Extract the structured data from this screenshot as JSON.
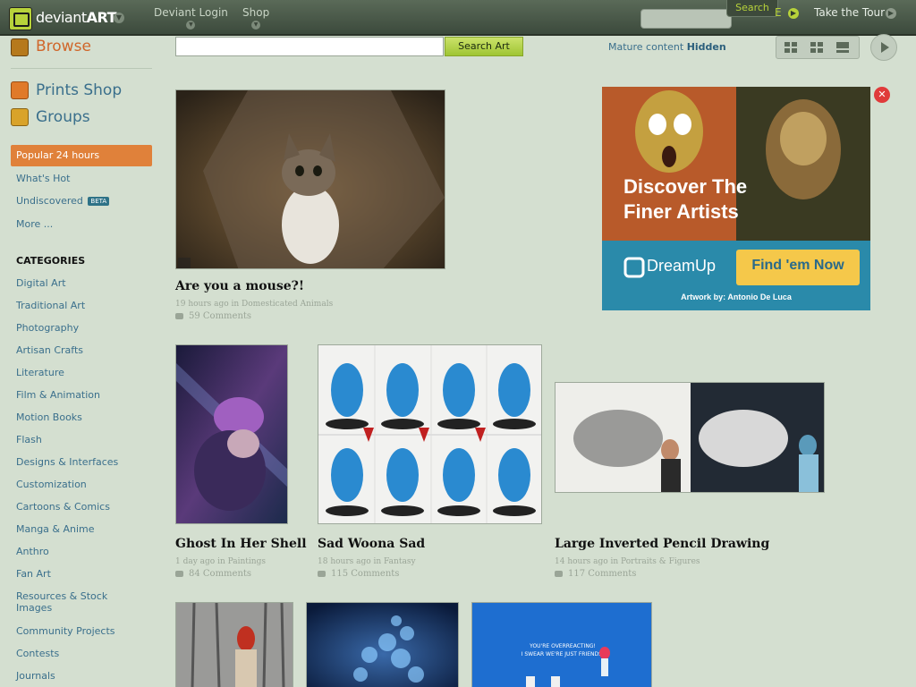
{
  "header": {
    "logo_text_light": "deviant",
    "logo_text_bold": "ART",
    "nav": [
      "Deviant Login",
      "Shop"
    ],
    "search_tab": "Search",
    "join_partial": "E",
    "take_tour": "Take the Tour"
  },
  "sidebar": {
    "browse": "Browse",
    "prints_shop": "Prints Shop",
    "groups": "Groups",
    "popular": "Popular 24 hours",
    "links": [
      "What's Hot",
      "Undiscovered",
      "More ..."
    ],
    "beta": "BETA",
    "categories_heading": "CATEGORIES",
    "categories": [
      "Digital Art",
      "Traditional Art",
      "Photography",
      "Artisan Crafts",
      "Literature",
      "Film & Animation",
      "Motion Books",
      "Flash",
      "Designs & Interfaces",
      "Customization",
      "Cartoons & Comics",
      "Manga & Anime",
      "Anthro",
      "Fan Art",
      "Resources & Stock Images",
      "Community Projects",
      "Contests",
      "Journals"
    ]
  },
  "toolbar": {
    "search_button": "Search Art",
    "mature_label": "Mature content",
    "mature_value": "Hidden"
  },
  "artworks": [
    {
      "title": "Are you a mouse?!",
      "meta": "19 hours ago in Domesticated Animals",
      "comments": "59 Comments"
    },
    {
      "title": "Ghost In Her Shell",
      "meta": "1 day ago in Paintings",
      "comments": "84 Comments"
    },
    {
      "title": "Sad Woona Sad",
      "meta": "18 hours ago in Fantasy",
      "comments": "115 Comments"
    },
    {
      "title": "Large Inverted Pencil Drawing",
      "meta": "14 hours ago in Portraits & Figures",
      "comments": "117 Comments"
    }
  ],
  "ad": {
    "headline1": "Discover The",
    "headline2": "Finer Artists",
    "brand": "DreamUp",
    "cta": "Find 'em Now",
    "credit": "Artwork by: Antonio De Luca"
  },
  "bottom_thumb_text": {
    "line1": "YOU'RE OVERREACTING!",
    "line2": "I SWEAR WE'RE JUST FRIENDS!"
  }
}
